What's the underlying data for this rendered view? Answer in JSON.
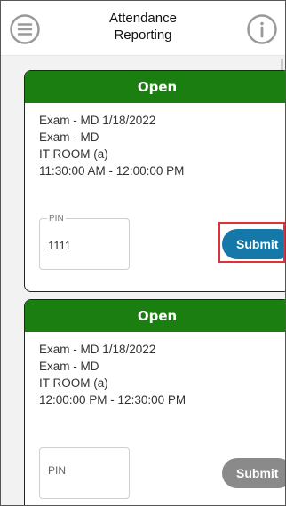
{
  "header": {
    "title_line1": "Attendance",
    "title_line2": "Reporting",
    "menu_icon": "hamburger-menu-icon",
    "info_icon": "info-icon"
  },
  "cards": [
    {
      "status": "Open",
      "lines": [
        "Exam - MD 1/18/2022",
        "Exam - MD",
        "IT ROOM (a)",
        "11:30:00 AM - 12:00:00 PM"
      ],
      "pin_label": "PIN",
      "pin_value": "1111",
      "submit_label": "Submit",
      "submit_state": "active"
    },
    {
      "status": "Open",
      "lines": [
        "Exam - MD 1/18/2022",
        "Exam - MD",
        "IT ROOM (a)",
        "12:00:00 PM - 12:30:00 PM"
      ],
      "pin_placeholder": "PIN",
      "submit_label": "Submit",
      "submit_state": "disabled"
    }
  ],
  "colors": {
    "status_green": "#1a7f10",
    "submit_active": "#1478a8",
    "submit_disabled": "#8a8a8a",
    "highlight": "#e0303a"
  }
}
